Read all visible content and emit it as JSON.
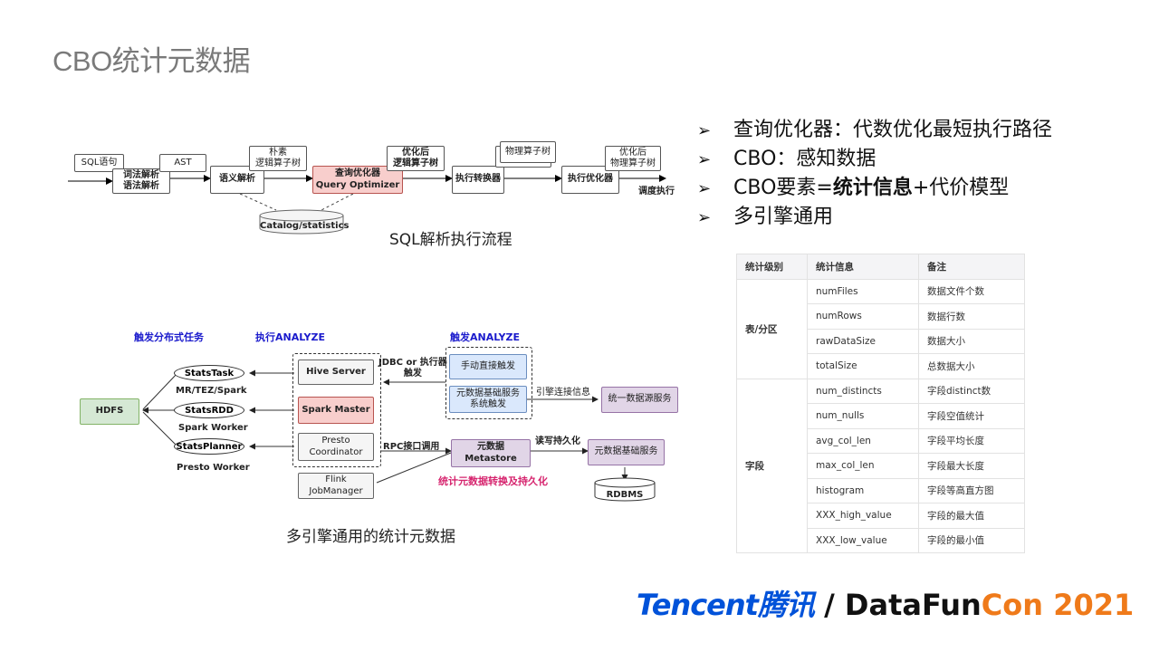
{
  "slide": {
    "title": "CBO统计元数据"
  },
  "sql_flow": {
    "caption": "SQL解析执行流程",
    "sql_statement": "SQL语句",
    "lexer": "词法解析\n语法解析",
    "ast": "AST",
    "semantic": "语义解析",
    "naive_tree": "朴素\n逻辑算子树",
    "optimizer_cn": "查询优化器",
    "optimizer_en": "Query Optimizer",
    "optimized_logical": "优化后\n逻辑算子树",
    "exec_converter": "执行转换器",
    "physical_tree": "物理算子树",
    "exec_optimizer": "执行优化器",
    "optimized_physical": "优化后\n物理算子树",
    "schedule": "调度执行",
    "catalog": "Catalog/statistics"
  },
  "multi_engine": {
    "caption": "多引擎通用的统计元数据",
    "heading_distributed": "触发分布式任务",
    "heading_execute": "执行ANALYZE",
    "heading_trigger": "触发ANALYZE",
    "hdfs": "HDFS",
    "stats_task": "StatsTask",
    "stats_task_engine": "MR/TEZ/Spark",
    "stats_rdd": "StatsRDD",
    "stats_rdd_engine": "Spark Worker",
    "stats_planner": "StatsPlanner",
    "stats_planner_engine": "Presto Worker",
    "hive_server": "Hive Server",
    "spark_master": "Spark Master",
    "presto_coordinator": "Presto\nCoordinator",
    "flink_jobmanager": "Flink\nJobManager",
    "jdbc_label": "JDBC or 执行器\n触发",
    "manual_trigger": "手动直接触发",
    "system_trigger": "元数据基础服务\n系统触发",
    "engine_conn_label": "引擎连接信息",
    "unified_datasource": "统一数据源服务",
    "rpc_label": "RPC接口调用",
    "metastore": "元数据\nMetastore",
    "rw_persist_label": "读写持久化",
    "metadata_service": "元数据基础服务",
    "rdbms": "RDBMS",
    "persist_title": "统计元数据转换及持久化"
  },
  "bullets": [
    {
      "text": "查询优化器：代数优化最短执行路径"
    },
    {
      "text_pre": "CBO：感知数据"
    },
    {
      "text_pre": "CBO要素=",
      "text_bold": "统计信息",
      "text_post": "+代价模型"
    },
    {
      "text": "多引擎通用"
    }
  ],
  "bullet_marker": "➢",
  "stats_table": {
    "headers": [
      "统计级别",
      "统计信息",
      "备注"
    ],
    "groups": [
      {
        "level": "表/分区",
        "rows": [
          [
            "numFiles",
            "数据文件个数"
          ],
          [
            "numRows",
            "数据行数"
          ],
          [
            "rawDataSize",
            "数据大小"
          ],
          [
            "totalSize",
            "总数据大小"
          ]
        ]
      },
      {
        "level": "字段",
        "rows": [
          [
            "num_distincts",
            "字段distinct数"
          ],
          [
            "num_nulls",
            "字段空值统计"
          ],
          [
            "avg_col_len",
            "字段平均长度"
          ],
          [
            "max_col_len",
            "字段最大长度"
          ],
          [
            "histogram",
            "字段等高直方图"
          ],
          [
            "XXX_high_value",
            "字段的最大值"
          ],
          [
            "XXX_low_value",
            "字段的最小值"
          ]
        ]
      }
    ]
  },
  "footer": {
    "tencent": "Tencent",
    "tencent_cn": "腾讯",
    "separator": "/",
    "datafun": "DataFun",
    "con": "Con 2021"
  },
  "colors": {
    "title_gray": "#7a7a7a",
    "tencent_blue": "#0052d9",
    "datafuncon_orange": "#ef7a1a",
    "heading_blue": "#1a1acc",
    "persist_pink": "#d6246e"
  }
}
